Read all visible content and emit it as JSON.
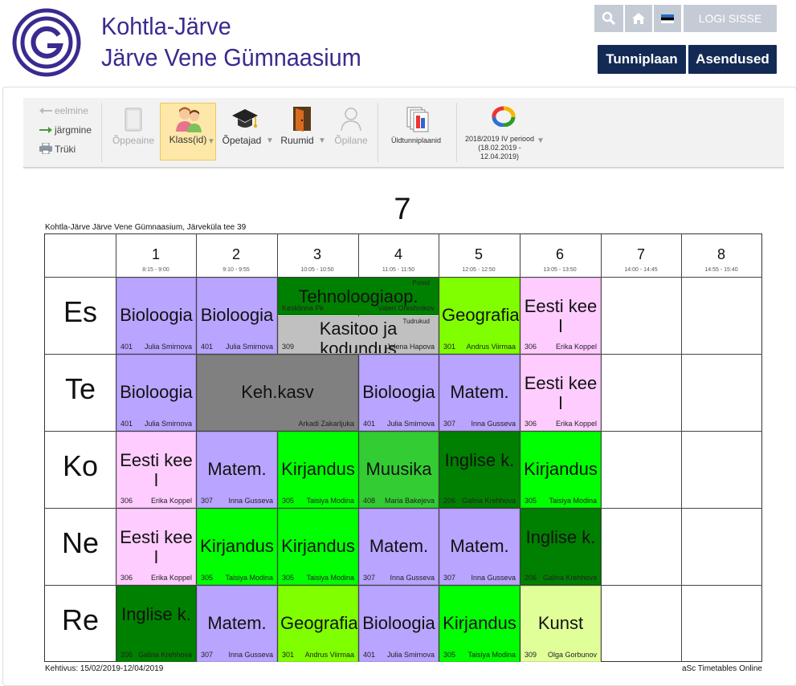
{
  "header": {
    "school_line1": "Kohtla-Järve",
    "school_line2": "Järve Vene Gümnaasium",
    "login_label": "LOGI SISSE",
    "nav_timetable": "Tunniplaan",
    "nav_substitutions": "Asendused",
    "colors": {
      "brand": "#3b2a8f",
      "nav": "#132a55",
      "topbtn": "#c5cbd5"
    },
    "icons": [
      "search-icon",
      "home-icon",
      "estonia-flag-icon"
    ]
  },
  "toolbar": {
    "prev_label": "eelmine",
    "next_label": "järgmine",
    "print_label": "Trüki",
    "subject_label": "Õppeaine",
    "classes_label": "Klass(id)",
    "teachers_label": "Õpetajad",
    "rooms_label": "Ruumid",
    "student_label": "Õpilane",
    "overall_label": "Üldtunniplaanid",
    "period_label": "2018/2019 IV periood (18.02.2019 - 12.04.2019)"
  },
  "timetable": {
    "title": "7",
    "school_address": "Kohtla-Järve Järve Vene Gümnaasium, Järveküla tee 39",
    "validity": "Kehtivus: 15/02/2019-12/04/2019",
    "footer": "aSc Timetables Online",
    "periods": [
      {
        "num": "1",
        "time": "8:15 - 9:00"
      },
      {
        "num": "2",
        "time": "9:10 - 9:55"
      },
      {
        "num": "3",
        "time": "10:05 - 10:50"
      },
      {
        "num": "4",
        "time": "11:05 - 11:50"
      },
      {
        "num": "5",
        "time": "12:05 - 12:50"
      },
      {
        "num": "6",
        "time": "13:05 - 13:50"
      },
      {
        "num": "7",
        "time": "14:00 - 14:45"
      },
      {
        "num": "8",
        "time": "14:55 - 15:40"
      }
    ],
    "days": [
      "Es",
      "Te",
      "Ko",
      "Ne",
      "Re"
    ],
    "lessons": [
      {
        "day": 0,
        "period": 0,
        "span": 1,
        "half": "full",
        "subject": "Bioloogia",
        "room": "401",
        "teacher": "Julia Smirnova",
        "group": "",
        "color": "#b9a4ff"
      },
      {
        "day": 0,
        "period": 1,
        "span": 1,
        "half": "full",
        "subject": "Bioloogia",
        "room": "401",
        "teacher": "Julia Smirnova",
        "group": "",
        "color": "#b9a4ff"
      },
      {
        "day": 0,
        "period": 2,
        "span": 2,
        "half": "top",
        "subject": "Tehnoloogiaop.",
        "room": "Kesklinna Pk",
        "teacher": "Valeri Oreshnikov",
        "group": "Poisid",
        "color": "#008000"
      },
      {
        "day": 0,
        "period": 2,
        "span": 2,
        "half": "bottom",
        "subject": "Kasitoo ja kodundus",
        "room": "309",
        "teacher": "Jelena Hapova",
        "group": "Tudrukud",
        "color": "#c0c0c0"
      },
      {
        "day": 0,
        "period": 4,
        "span": 1,
        "half": "full",
        "subject": "Geografia",
        "room": "301",
        "teacher": "Andrus Viirmaa",
        "group": "",
        "color": "#80ff00"
      },
      {
        "day": 0,
        "period": 5,
        "span": 1,
        "half": "full",
        "subject": "Eesti keel",
        "room": "306",
        "teacher": "Erika Koppel",
        "group": "",
        "color": "#ffccff"
      },
      {
        "day": 1,
        "period": 0,
        "span": 1,
        "half": "full",
        "subject": "Bioloogia",
        "room": "401",
        "teacher": "Julia Smirnova",
        "group": "",
        "color": "#b9a4ff"
      },
      {
        "day": 1,
        "period": 1,
        "span": 2,
        "half": "full",
        "subject": "Keh.kasv",
        "room": "",
        "teacher": "Arkadi Zakarljuka",
        "group": "",
        "color": "#808080"
      },
      {
        "day": 1,
        "period": 3,
        "span": 1,
        "half": "full",
        "subject": "Bioloogia",
        "room": "401",
        "teacher": "Julia Smirnova",
        "group": "",
        "color": "#b9a4ff"
      },
      {
        "day": 1,
        "period": 4,
        "span": 1,
        "half": "full",
        "subject": "Matem.",
        "room": "307",
        "teacher": "Inna Gusseva",
        "group": "",
        "color": "#b9a4ff"
      },
      {
        "day": 1,
        "period": 5,
        "span": 1,
        "half": "full",
        "subject": "Eesti keel",
        "room": "306",
        "teacher": "Erika Koppel",
        "group": "",
        "color": "#ffccff"
      },
      {
        "day": 2,
        "period": 0,
        "span": 1,
        "half": "full",
        "subject": "Eesti keel",
        "room": "306",
        "teacher": "Erika Koppel",
        "group": "",
        "color": "#ffccff"
      },
      {
        "day": 2,
        "period": 1,
        "span": 1,
        "half": "full",
        "subject": "Matem.",
        "room": "307",
        "teacher": "Inna Gusseva",
        "group": "",
        "color": "#b9a4ff"
      },
      {
        "day": 2,
        "period": 2,
        "span": 1,
        "half": "full",
        "subject": "Kirjandus",
        "room": "305",
        "teacher": "Taisiya Modina",
        "group": "",
        "color": "#00ff00"
      },
      {
        "day": 2,
        "period": 3,
        "span": 1,
        "half": "full",
        "subject": "Muusika",
        "room": "408",
        "teacher": "Maria Bakejeva",
        "group": "",
        "color": "#33cc33"
      },
      {
        "day": 2,
        "period": 4,
        "span": 1,
        "half": "full",
        "subject": "Inglise k.",
        "room": "206",
        "teacher": "Galina Krehhova",
        "group": "",
        "color": "#008000"
      },
      {
        "day": 2,
        "period": 5,
        "span": 1,
        "half": "full",
        "subject": "Kirjandus",
        "room": "305",
        "teacher": "Taisiya Modina",
        "group": "",
        "color": "#00ff00"
      },
      {
        "day": 3,
        "period": 0,
        "span": 1,
        "half": "full",
        "subject": "Eesti keel",
        "room": "306",
        "teacher": "Erika Koppel",
        "group": "",
        "color": "#ffccff"
      },
      {
        "day": 3,
        "period": 1,
        "span": 1,
        "half": "full",
        "subject": "Kirjandus",
        "room": "305",
        "teacher": "Taisiya Modina",
        "group": "",
        "color": "#00ff00"
      },
      {
        "day": 3,
        "period": 2,
        "span": 1,
        "half": "full",
        "subject": "Kirjandus",
        "room": "305",
        "teacher": "Taisiya Modina",
        "group": "",
        "color": "#00ff00"
      },
      {
        "day": 3,
        "period": 3,
        "span": 1,
        "half": "full",
        "subject": "Matem.",
        "room": "307",
        "teacher": "Inna Gusseva",
        "group": "",
        "color": "#b9a4ff"
      },
      {
        "day": 3,
        "period": 4,
        "span": 1,
        "half": "full",
        "subject": "Matem.",
        "room": "307",
        "teacher": "Inna Gusseva",
        "group": "",
        "color": "#b9a4ff"
      },
      {
        "day": 3,
        "period": 5,
        "span": 1,
        "half": "full",
        "subject": "Inglise k.",
        "room": "206",
        "teacher": "Galina Krehhova",
        "group": "",
        "color": "#008000"
      },
      {
        "day": 4,
        "period": 0,
        "span": 1,
        "half": "full",
        "subject": "Inglise k.",
        "room": "206",
        "teacher": "Galina Krehhova",
        "group": "",
        "color": "#008000"
      },
      {
        "day": 4,
        "period": 1,
        "span": 1,
        "half": "full",
        "subject": "Matem.",
        "room": "307",
        "teacher": "Inna Gusseva",
        "group": "",
        "color": "#b9a4ff"
      },
      {
        "day": 4,
        "period": 2,
        "span": 1,
        "half": "full",
        "subject": "Geografia",
        "room": "301",
        "teacher": "Andrus Viirmaa",
        "group": "",
        "color": "#80ff00"
      },
      {
        "day": 4,
        "period": 3,
        "span": 1,
        "half": "full",
        "subject": "Bioloogia",
        "room": "401",
        "teacher": "Julia Smirnova",
        "group": "",
        "color": "#b9a4ff"
      },
      {
        "day": 4,
        "period": 4,
        "span": 1,
        "half": "full",
        "subject": "Kirjandus",
        "room": "305",
        "teacher": "Taisiya Modina",
        "group": "",
        "color": "#00ff00"
      },
      {
        "day": 4,
        "period": 5,
        "span": 1,
        "half": "full",
        "subject": "Kunst",
        "room": "309",
        "teacher": "Olga Gorbunov",
        "group": "",
        "color": "#e0ff99"
      }
    ]
  }
}
